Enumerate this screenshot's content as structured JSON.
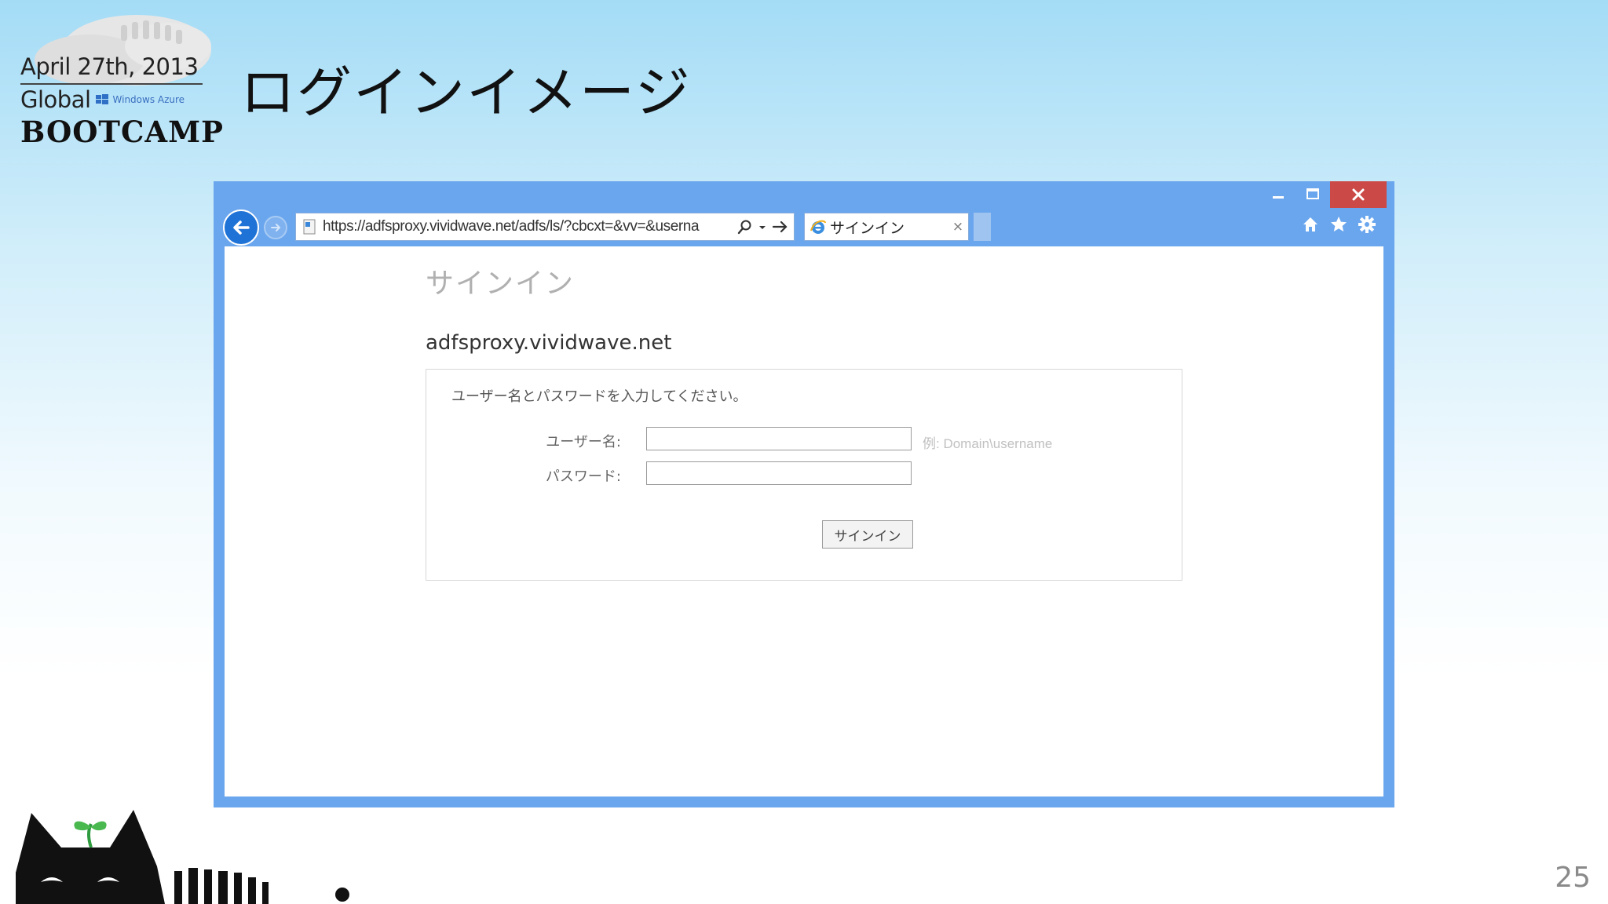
{
  "logo": {
    "date": "April 27th, 2013",
    "global": "Global",
    "azure": "Windows Azure",
    "bootcamp": "BOOTCAMP"
  },
  "slide": {
    "title": "ログインイメージ",
    "page_number": "25"
  },
  "browser": {
    "address_url": "https://adfsproxy.vividwave.net/adfs/ls/?cbcxt=&vv=&userna",
    "tab_title": "サインイン",
    "tab_close_glyph": "×",
    "window_close_glyph": "✕",
    "window_minimize_glyph": "–",
    "window_maximize_glyph": "☐",
    "chrome_color": "#6aa6ee",
    "close_color": "#cb4a47"
  },
  "page": {
    "heading": "サインイン",
    "server": "adfsproxy.vividwave.net",
    "instructions": "ユーザー名とパスワードを入力してください。",
    "username_label": "ユーザー名:",
    "password_label": "パスワード:",
    "username_value": "",
    "password_value": "",
    "username_hint": "例: Domain\\username",
    "signin_button": "サインイン"
  }
}
